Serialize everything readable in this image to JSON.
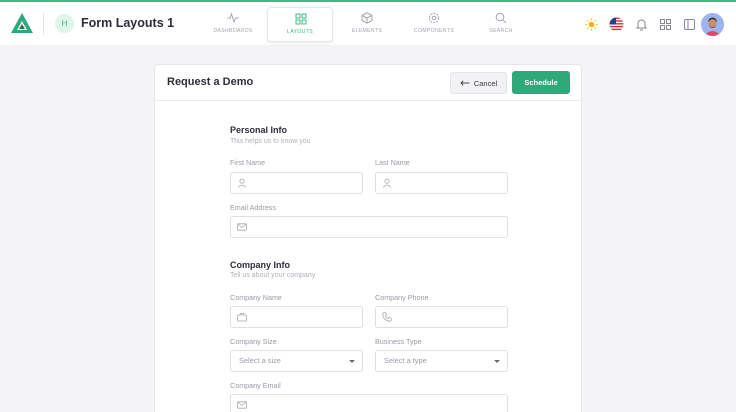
{
  "header": {
    "avatar_letter": "H",
    "title": "Form Layouts 1",
    "nav": [
      {
        "label": "DASHBOARDS",
        "icon": "activity-icon"
      },
      {
        "label": "LAYOUTS",
        "icon": "grid-icon",
        "active": true
      },
      {
        "label": "ELEMENTS",
        "icon": "box-icon"
      },
      {
        "label": "COMPONENTS",
        "icon": "settings-icon"
      },
      {
        "label": "SEARCH",
        "icon": "search-icon"
      }
    ]
  },
  "card": {
    "title": "Request a Demo",
    "cancel_label": "Cancel",
    "schedule_label": "Schedule"
  },
  "personal": {
    "title": "Personal Info",
    "subtitle": "This helps us to know you",
    "first_name_label": "First Name",
    "last_name_label": "Last Name",
    "email_label": "Email Address"
  },
  "company": {
    "title": "Company Info",
    "subtitle": "Tell us about your company",
    "name_label": "Company Name",
    "phone_label": "Company Phone",
    "size_label": "Company Size",
    "size_placeholder": "Select a size",
    "type_label": "Business Type",
    "type_placeholder": "Select a type",
    "email_label": "Company Email"
  },
  "colors": {
    "accent": "#41b883",
    "primary_button": "#2fa97a"
  }
}
